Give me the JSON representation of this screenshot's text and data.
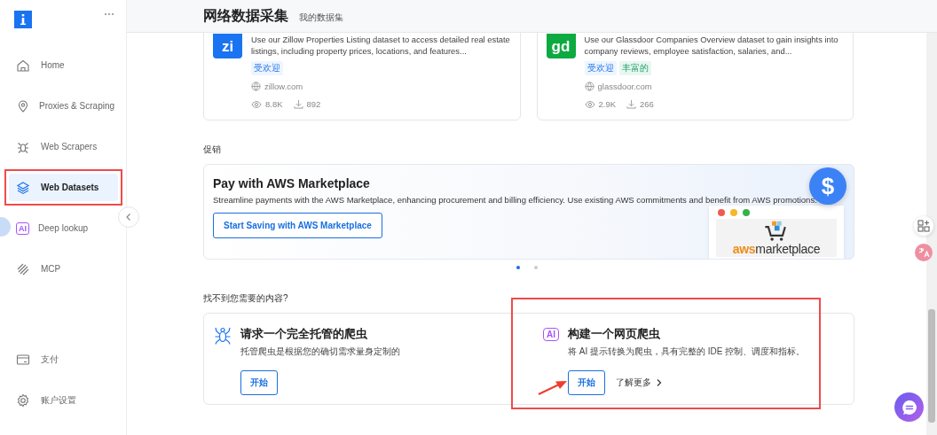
{
  "sidebar": {
    "items": [
      {
        "label": "Home",
        "selected": false,
        "highlighted": false
      },
      {
        "label": "Proxies & Scraping",
        "selected": false,
        "highlighted": false
      },
      {
        "label": "Web Scrapers",
        "selected": false,
        "highlighted": false
      },
      {
        "label": "Web Datasets",
        "selected": true,
        "highlighted": true
      },
      {
        "label": "Deep lookup",
        "badge": "AI",
        "selected": false,
        "highlighted": false
      },
      {
        "label": "MCP",
        "selected": false,
        "highlighted": false
      }
    ],
    "footer_items": [
      {
        "label": "支付",
        "selected": false
      },
      {
        "label": "账户设置",
        "selected": false
      }
    ]
  },
  "header": {
    "title": "网络数据采集",
    "subtitle": "我的数据集"
  },
  "datasets": [
    {
      "logo": "zi",
      "color": "#1a73f0",
      "description": "Use our Zillow Properties Listing dataset to access detailed real estate listings, including property prices, locations, and features...",
      "tags": [
        {
          "label": "受欢迎",
          "kind": "popular"
        }
      ],
      "domain": "zillow.com",
      "views": "8.8K",
      "downloads": "892"
    },
    {
      "logo": "gd",
      "color": "#0caa41",
      "description": "Use our Glassdoor Companies Overview dataset to gain insights into company reviews, employee satisfaction, salaries, and...",
      "tags": [
        {
          "label": "受欢迎",
          "kind": "popular"
        },
        {
          "label": "丰富的",
          "kind": "rich"
        }
      ],
      "domain": "glassdoor.com",
      "views": "2.9K",
      "downloads": "266"
    }
  ],
  "promotions": {
    "heading": "促销",
    "banner": {
      "title": "Pay with AWS Marketplace",
      "description": "Streamline payments with the AWS Marketplace, enhancing procurement and billing efficiency. Use existing AWS commitments and benefit from AWS promotions.",
      "button": "Start Saving with AWS Marketplace",
      "badge": "$",
      "logo_prefix": "aws",
      "logo_suffix": "marketplace"
    },
    "carousel_dots": [
      {
        "selected": true
      },
      {
        "selected": false
      }
    ]
  },
  "help": {
    "heading": "找不到您需要的内容?",
    "options": [
      {
        "kind": "spider",
        "title": "请求一个完全托管的爬虫",
        "description": "托管爬虫是根据您的确切需求量身定制的",
        "button": "开始",
        "highlighted": false
      },
      {
        "kind": "ai",
        "badge": "AI",
        "title": "构建一个网页爬虫",
        "description": "将 AI 提示转换为爬虫，具有完整的 IDE 控制、调度和指标。",
        "button": "开始",
        "link": "了解更多",
        "highlighted": true
      }
    ]
  }
}
